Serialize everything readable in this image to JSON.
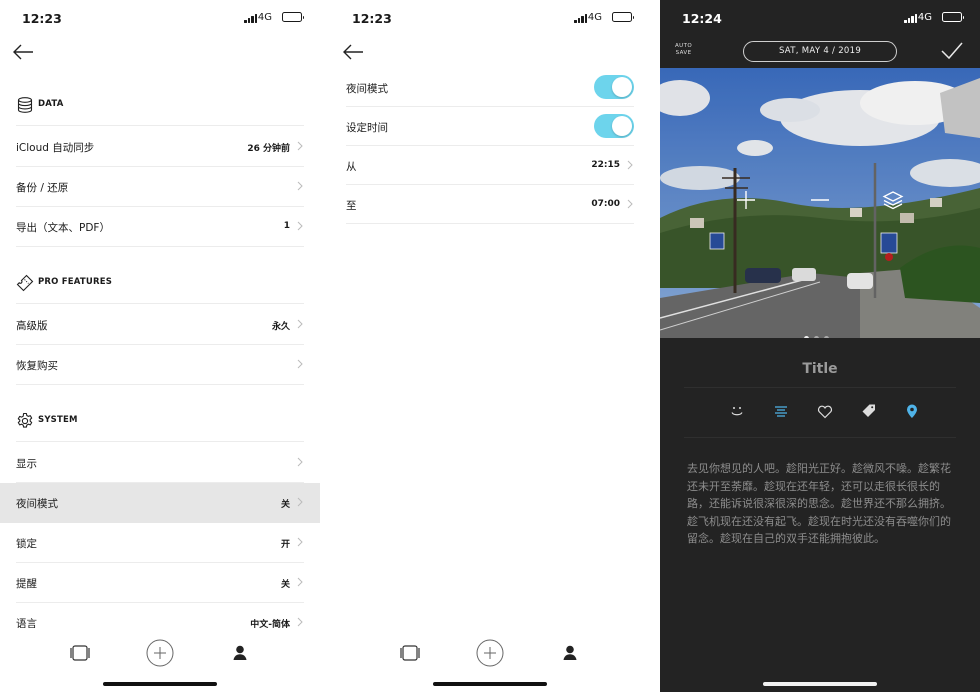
{
  "colors": {
    "toggle_on": "#6dd4ec",
    "pin_blue": "#4fb3e8",
    "dark_bg": "#232323",
    "highlight": "#e6e6e6"
  },
  "screen1": {
    "status": {
      "time": "12:23",
      "network": "4G"
    },
    "sections": {
      "data": "DATA",
      "pro": "PRO FEATURES",
      "system": "SYSTEM"
    },
    "rows": {
      "icloud": {
        "label": "iCloud 自动同步",
        "value": "26 分钟前"
      },
      "backup": {
        "label": "备份 / 还原",
        "value": ""
      },
      "export": {
        "label": "导出（文本、PDF）",
        "value": "1"
      },
      "premium": {
        "label": "高级版",
        "value": "永久"
      },
      "restore": {
        "label": "恢复购买",
        "value": ""
      },
      "display": {
        "label": "显示",
        "value": ""
      },
      "night": {
        "label": "夜间模式",
        "value": "关"
      },
      "lock": {
        "label": "锁定",
        "value": "开"
      },
      "reminder": {
        "label": "提醒",
        "value": "关"
      },
      "language": {
        "label": "语言",
        "value": "中文-简体"
      }
    }
  },
  "screen2": {
    "status": {
      "time": "12:23",
      "network": "4G"
    },
    "rows": {
      "night_mode": {
        "label": "夜间模式",
        "on": true
      },
      "set_time": {
        "label": "设定时间",
        "on": true
      },
      "from": {
        "label": "从",
        "value": "22:15"
      },
      "to": {
        "label": "至",
        "value": "07:00"
      }
    }
  },
  "screen3": {
    "status": {
      "time": "12:24",
      "network": "4G"
    },
    "auto_save": [
      "AUTO",
      "SAVE"
    ],
    "date": "SAT, MAY 4 / 2019",
    "title": "Title",
    "body": "去见你想见的人吧。趁阳光正好。趁微风不噪。趁繁花还未开至荼靡。趁现在还年轻，还可以走很长很长的路，还能诉说很深很深的思念。趁世界还不那么拥挤。趁飞机现在还没有起飞。趁现在时光还没有吞噬你们的留念。趁现在自己的双手还能拥抱彼此。",
    "photo_pages": 3,
    "photo_current": 1,
    "toolbar_icons": [
      "smile-icon",
      "text-align-icon",
      "heart-icon",
      "tag-icon",
      "location-pin-icon"
    ]
  }
}
